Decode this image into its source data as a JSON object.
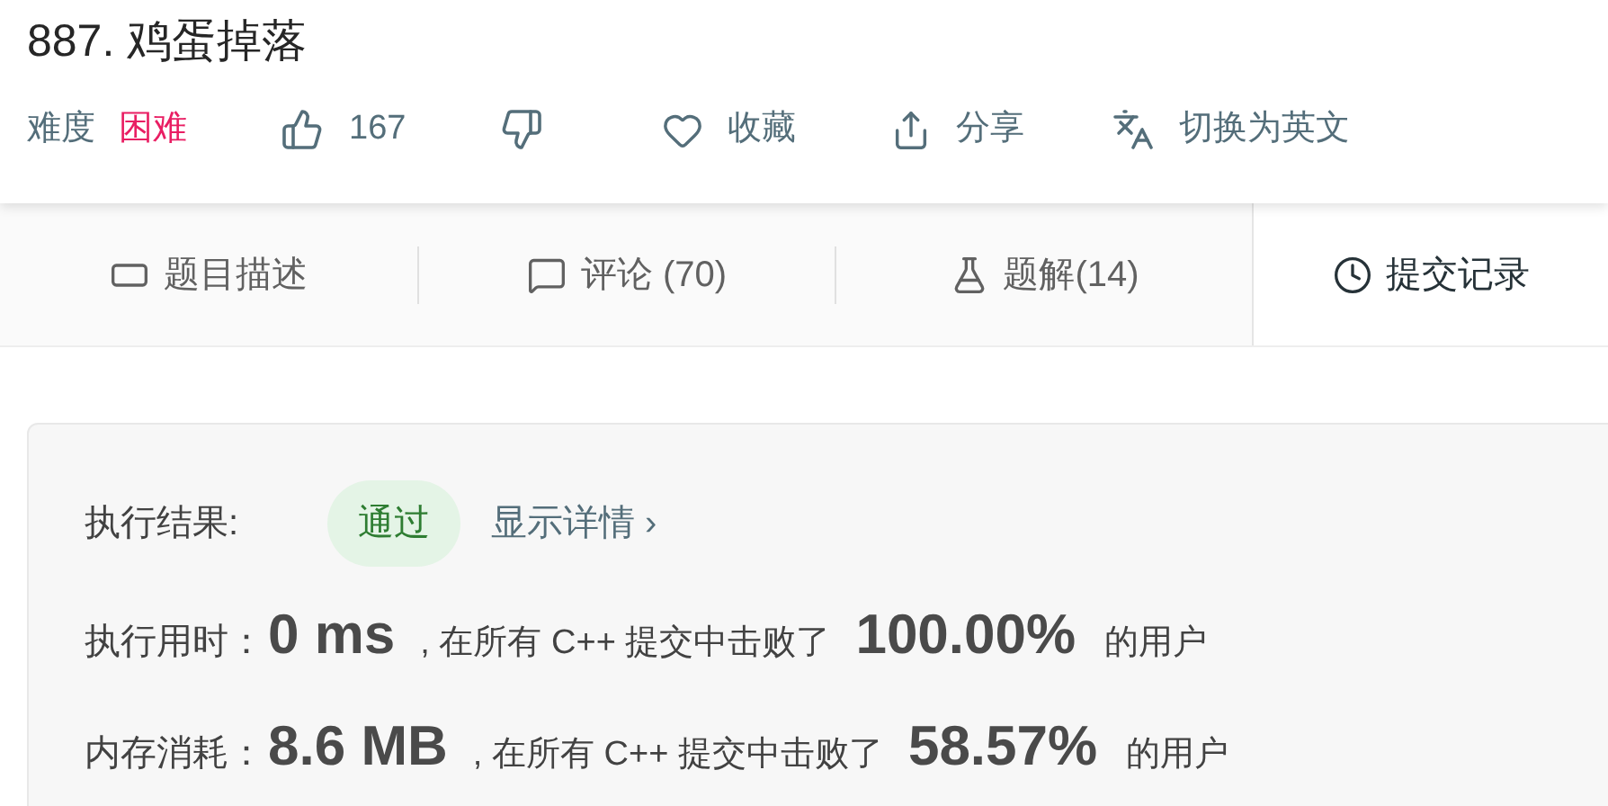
{
  "title": "887. 鸡蛋掉落",
  "meta": {
    "difficulty_label": "难度",
    "difficulty": "困难",
    "likes": "167",
    "favorite": "收藏",
    "share": "分享",
    "translate": "切换为英文"
  },
  "tabs": [
    {
      "kind": "description",
      "label": "题目描述",
      "selected": false
    },
    {
      "kind": "comments",
      "label": "评论 (70)",
      "selected": false
    },
    {
      "kind": "solutions",
      "label": "题解(14)",
      "selected": false
    },
    {
      "kind": "submissions",
      "label": "提交记录",
      "selected": true
    }
  ],
  "result": {
    "label": "执行结果:",
    "status": "通过",
    "details": "显示详情 ›"
  },
  "stats": [
    {
      "label": "执行用时：",
      "value": "0 ms",
      "text": ", 在所有 C++ 提交中击败了",
      "percent": "100.00%",
      "suffix": "的用户"
    },
    {
      "label": "内存消耗：",
      "value": "8.6 MB",
      "text": ", 在所有 C++ 提交中击败了",
      "percent": "58.57%",
      "suffix": "的用户"
    }
  ]
}
